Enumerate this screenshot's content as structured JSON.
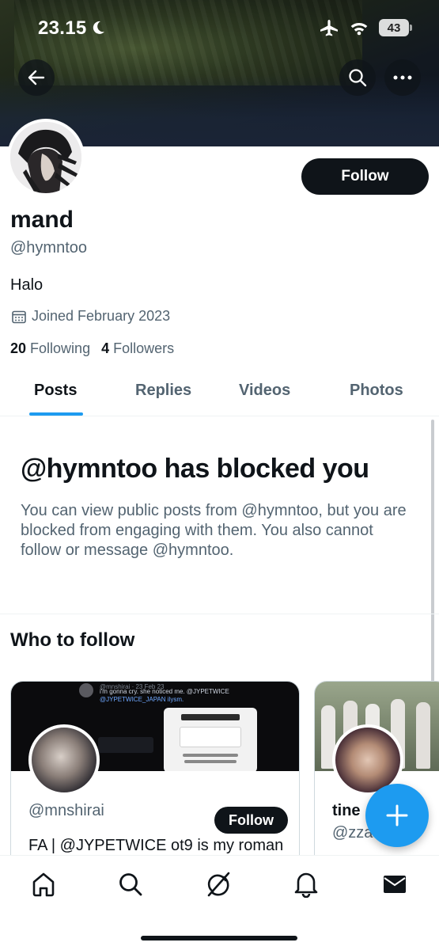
{
  "status_bar": {
    "time": "23.15",
    "battery": "43"
  },
  "profile": {
    "display_name": "mand",
    "handle": "@hymntoo",
    "bio": "Halo",
    "joined": "Joined February 2023",
    "following_count": "20",
    "following_label": "Following",
    "followers_count": "4",
    "followers_label": "Followers",
    "follow_label": "Follow"
  },
  "tabs": [
    {
      "label": "Posts",
      "active": true
    },
    {
      "label": "Replies",
      "active": false
    },
    {
      "label": "Videos",
      "active": false
    },
    {
      "label": "Photos",
      "active": false
    }
  ],
  "blocked": {
    "title": "@hymntoo has blocked you",
    "body": "You can view public posts from @hymntoo, but you are blocked from engaging with them. You also cannot follow or message @hymntoo."
  },
  "who_to_follow": {
    "title": "Who to follow",
    "cards": [
      {
        "handle": "@mnshirai",
        "follow_label": "Follow",
        "bio": "FA | @JYPETWICE ot9 is my roman",
        "banner_text_1": "i'm gonna cry. she noticed me. @JYPETWICE",
        "banner_text_2": "@JYPETWICE_JAPAN ilysm."
      },
      {
        "name": "tine",
        "handle": "@zza"
      }
    ]
  },
  "bottom_nav": [
    "home-icon",
    "search-icon",
    "grok-icon",
    "notifications-icon",
    "messages-icon"
  ],
  "colors": {
    "accent": "#1d9bf0",
    "text": "#0f1419",
    "secondary": "#536471"
  }
}
